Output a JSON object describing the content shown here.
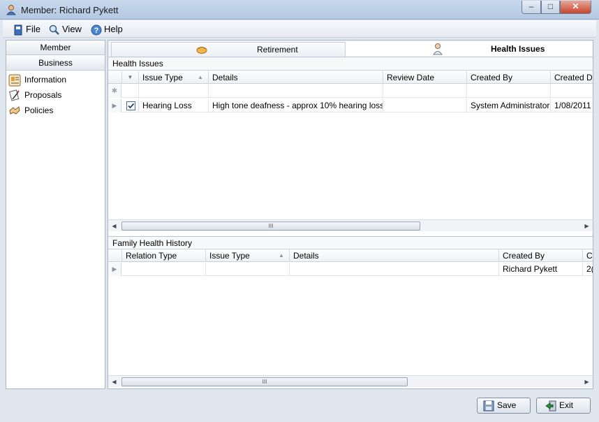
{
  "window": {
    "title": "Member: Richard Pykett"
  },
  "menu": {
    "file": "File",
    "view": "View",
    "help": "Help"
  },
  "nav": {
    "headers": [
      "Member",
      "Business"
    ],
    "items": [
      {
        "label": "Information",
        "icon": "info-icon"
      },
      {
        "label": "Proposals",
        "icon": "proposals-icon"
      },
      {
        "label": "Policies",
        "icon": "policies-icon"
      }
    ]
  },
  "tabs": [
    {
      "label": "Retirement",
      "icon": "retirement-icon"
    },
    {
      "label": "Health Issues",
      "icon": "health-icon",
      "active": true
    }
  ],
  "health_issues": {
    "title": "Health Issues",
    "columns": [
      "Issue Type",
      "Details",
      "Review Date",
      "Created By",
      "Created Da"
    ],
    "rows": [
      {
        "checked": true,
        "issue_type": "Hearing Loss",
        "details": "High tone deafness - approx 10% hearing loss",
        "review_date": "",
        "created_by": "System Administrator",
        "created_date": "1/08/2011"
      }
    ],
    "scroll_thumb": "III"
  },
  "family_history": {
    "title": "Family Health History",
    "columns": [
      "Relation Type",
      "Issue Type",
      "Details",
      "Created By",
      "C"
    ],
    "rows": [
      {
        "relation_type": "",
        "issue_type": "",
        "details": "",
        "created_by": "Richard Pykett",
        "created_date": "2("
      }
    ],
    "scroll_thumb": "III"
  },
  "buttons": {
    "save": "Save",
    "exit": "Exit"
  }
}
